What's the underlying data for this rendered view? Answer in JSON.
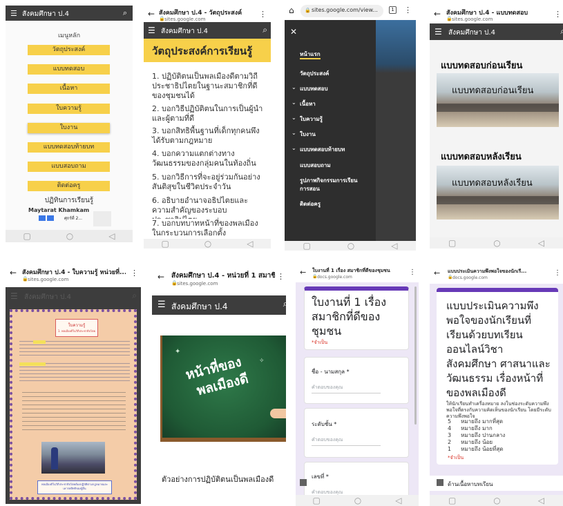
{
  "p1": {
    "site_title": "สังคมศึกษา ป.4",
    "menu_header": "เมนูหลัก",
    "buttons": [
      "วัตถุประสงค์",
      "แบบทดสอบ",
      "เนื้อหา",
      "ใบความรู้",
      "ใบงาน",
      "แบบทดสอบท้ายบท",
      "แบบสอบถาม",
      "ติดต่อครู"
    ],
    "footer_heading": "ปฏิทินการเรียนรู้",
    "author": "Maytarat Khamkam",
    "date": "ศุกร์ที่ 2..."
  },
  "p2": {
    "tab_title": "สังคมศึกษา ป.4 - วัตถุประสงค์",
    "url": "sites.google.com",
    "site_title": "สังคมศึกษา ป.4",
    "heading": "วัตถุประสงค์การเรียนรู้",
    "items": [
      "1. ปฏิบัติตนเป็นพลเมืองดีตามวิถีประชาธิปไตยในฐานะสมาชิกที่ดีของชุมชนได้",
      "2. บอกวิธีปฏิบัติตนในการเป็นผู้นำและผู้ตามที่ดี",
      "3. บอกสิทธิพื้นฐานที่เด็กทุกคนพึงได้รับตามกฎหมาย",
      "4. บอกความแตกต่างทางวัฒนธรรมของกลุ่มคนในท้องถิ่น",
      "5. บอกวิธีการที่จะอยู่ร่วมกันอย่างสันติสุขในชีวิตประจำวัน",
      "6. อธิบายอำนาจอธิปไตยและความสำคัญของระบอบประชาธิปไตย",
      "7. บอกบทบาทหน้าที่ของพลเมืองในกระบวนการเลือกตั้ง"
    ]
  },
  "p3": {
    "url": "sites.google.com/view...",
    "tab_count": "1",
    "menu": [
      "หน้าแรก",
      "วัตถุประสงค์",
      "แบบทดสอบ",
      "เนื้อหา",
      "ใบความรู้",
      "ใบงาน",
      "แบบทดสอบท้ายบท",
      "แบบสอบถาม",
      "รูปภาพกิจกรรมการเรียนการสอน",
      "ติดต่อครู"
    ]
  },
  "p4": {
    "tab_title": "สังคมศึกษา ป.4 - แบบทดสอบ",
    "url": "sites.google.com",
    "site_title": "สังคมศึกษา ป.4",
    "pre_heading": "แบบทดสอบก่อนเรียน",
    "pre_overlay": "แบบทดสอบก่อนเรียน",
    "post_heading": "แบบทดสอบหลังเรียน",
    "post_overlay": "แบบทดสอบหลังเรียน"
  },
  "p5": {
    "tab_title": "สังคมศึกษา ป.4 - ใบความรู้ หน่วยที่...",
    "url": "sites.google.com",
    "site_title": "สังคมศึกษา ป.4",
    "doc_title": "ใบความรู้",
    "doc_subtitle": "1. พลเมืองดีในวิถีประชาธิปไตย",
    "caption": "พลเมืองดีในวิถีประชาธิปไตยต้องปฏิบัติตามกฎหมายและเคารพสิทธิของผู้อื่น"
  },
  "p6": {
    "tab_title": "สังคมศึกษา ป.4 - หน่วยที่ 1 สมาชิก...",
    "url": "sites.google.com",
    "site_title": "สังคมศึกษา ป.4",
    "board_line1": "หน้าที่ของ",
    "board_line2": "พลเมืองดี",
    "section_heading": "ตัวอย่างการปฏิบัติตนเป็นพลเมืองดี"
  },
  "p7": {
    "tab_title": "ใบงานที่ 1 เรื่อง สมาชิกที่ดีของชุมชน",
    "url": "docs.google.com",
    "form_title": "ใบงานที่ 1 เรื่อง สมาชิกที่ดีของชุมชน",
    "required_note": "*จำเป็น",
    "q1": "ชื่อ - นามสกุล *",
    "q2": "ระดับชั้น *",
    "q3": "เลขที่ *",
    "answer_placeholder": "คำตอบของคุณ"
  },
  "p8": {
    "tab_title": "แบบประเมินความพึงพอใจของนักเรี...",
    "url": "docs.google.com",
    "form_title": "แบบประเมินความพึงพอใจของนักเรียนที่เรียนด้วยบทเรียนออนไลน์วิชาสังคมศึกษา ศาสนาและวัฒนธรรม เรื่องหน้าที่ของพลเมืองดี",
    "instructions": "ให้นักเรียนทำเครื่องหมาย ลงในช่องระดับความพึงพอใจที่ตรงกับความคิดเห็นของนักเรียน โดยมีระดับความพึงพอใจ",
    "scale": [
      {
        "n": "5",
        "label": "หมายถึง มากที่สุด"
      },
      {
        "n": "4",
        "label": "หมายถึง มาก"
      },
      {
        "n": "3",
        "label": "หมายถึง ปานกลาง"
      },
      {
        "n": "2",
        "label": "หมายถึง น้อย"
      },
      {
        "n": "1",
        "label": "หมายถึง น้อยที่สุด"
      }
    ],
    "required_note": "*จำเป็น",
    "section_label": "ด้านเนื้อหาบทเรียน"
  },
  "colors": {
    "yellow": "#f7d04a",
    "site_bar": "#3d3d3d",
    "form_purple": "#673ab7",
    "board_green": "#1f5a35",
    "required_red": "#d93025"
  }
}
